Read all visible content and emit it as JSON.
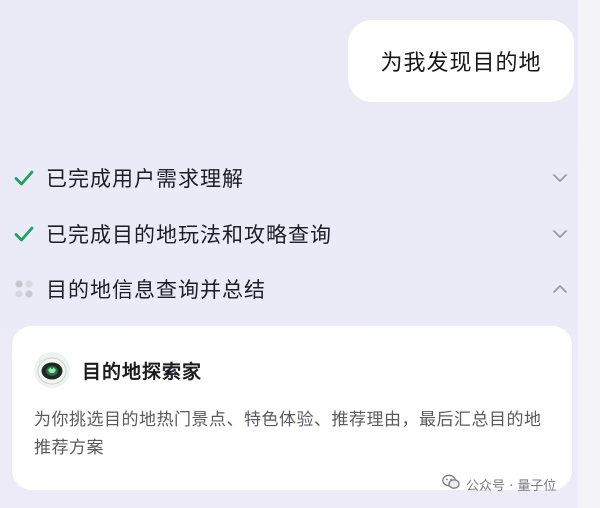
{
  "user_message": {
    "text": "为我发现目的地"
  },
  "steps": [
    {
      "label": "已完成用户需求理解",
      "status": "done",
      "status_icon": "check-icon",
      "chevron": "chevron-down-icon"
    },
    {
      "label": "已完成目的地玩法和攻略查询",
      "status": "done",
      "status_icon": "check-icon",
      "chevron": "chevron-down-icon"
    },
    {
      "label": "目的地信息查询并总结",
      "status": "in-progress",
      "status_icon": "loading-dots-icon",
      "chevron": "chevron-up-icon"
    }
  ],
  "agent_card": {
    "title": "目的地探索家",
    "description": "为你挑选目的地热门景点、特色体验、推荐理由，最后汇总目的地推荐方案",
    "avatar_icon": "explorer-robot-icon"
  },
  "watermark": {
    "text": "公众号 · 量子位",
    "icon": "wechat-icon"
  },
  "colors": {
    "background": "#e9eaf6",
    "check": "#1aa35c",
    "chevron": "#9a9aa6",
    "card": "#ffffff"
  }
}
